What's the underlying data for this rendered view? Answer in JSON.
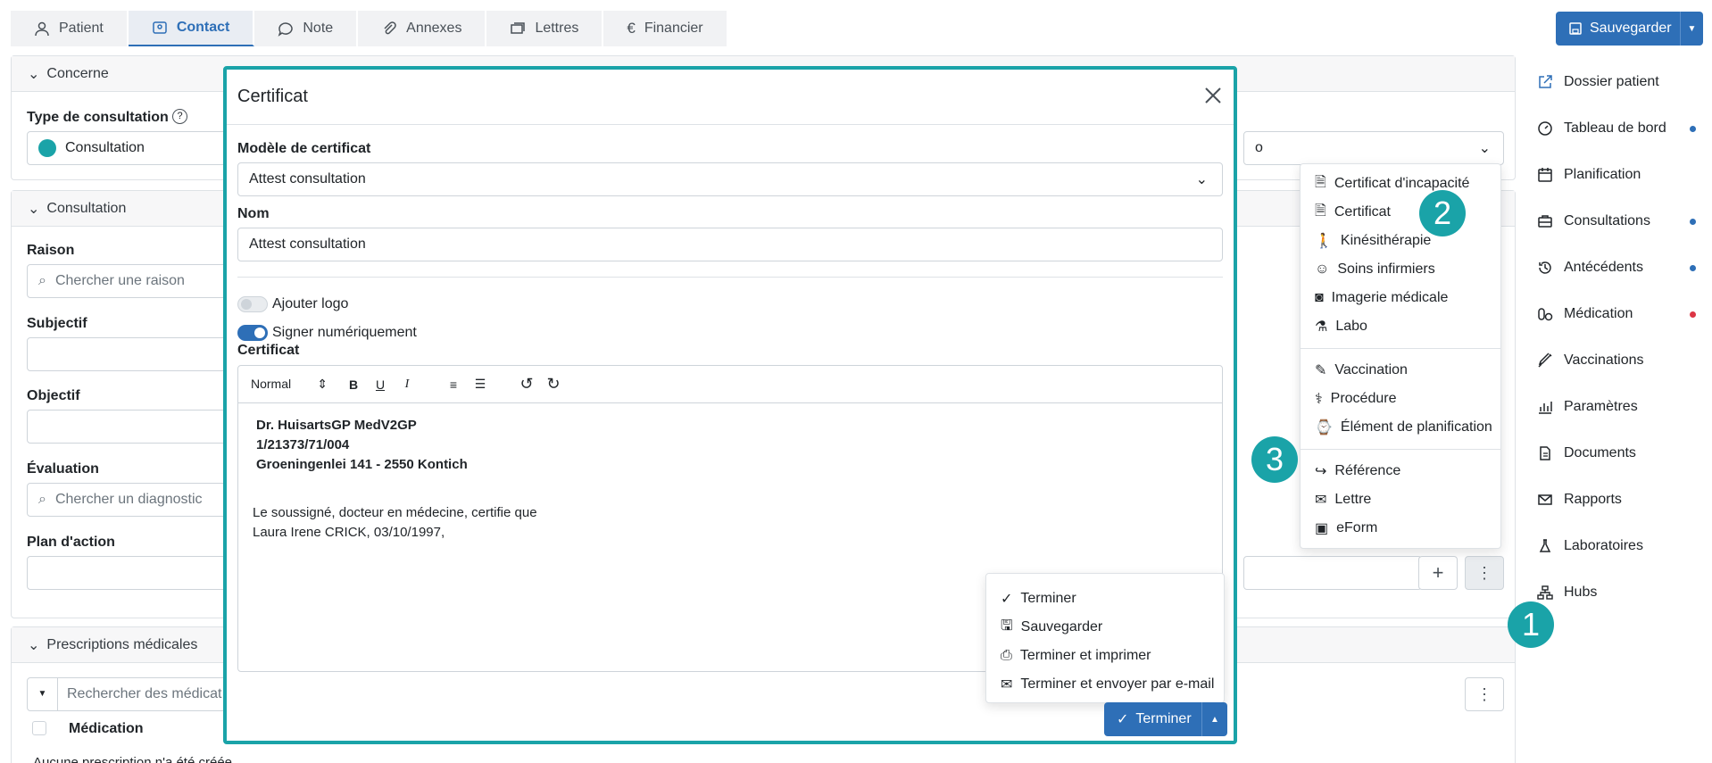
{
  "tabs": [
    {
      "label": "Patient",
      "icon": "user-icon"
    },
    {
      "label": "Contact",
      "icon": "contact-icon"
    },
    {
      "label": "Note",
      "icon": "note-icon"
    },
    {
      "label": "Annexes",
      "icon": "paperclip-icon"
    },
    {
      "label": "Lettres",
      "icon": "letters-icon"
    },
    {
      "label": "Financier",
      "icon": "euro-icon"
    }
  ],
  "save_button": "Sauvegarder",
  "background": {
    "concerne": "Concerne",
    "type_label": "Type de consultation",
    "type_value": "Consultation",
    "consultation": "Consultation",
    "raison": "Raison",
    "raison_placeholder": "Chercher une raison",
    "subjectif": "Subjectif",
    "objectif": "Objectif",
    "evaluation": "Évaluation",
    "evaluation_placeholder": "Chercher un diagnostic",
    "plan": "Plan d'action",
    "prescriptions": "Prescriptions médicales",
    "medication_search": "Rechercher des médicat",
    "medication_col": "Médication",
    "empty_text": "Aucune prescription n'a été créée",
    "right_select_fragment": "o"
  },
  "sidebar": [
    {
      "label": "Dossier patient",
      "icon": "external-link-icon",
      "dot": ""
    },
    {
      "label": "Tableau de bord",
      "icon": "dashboard-icon",
      "dot": "#2e6fb7"
    },
    {
      "label": "Planification",
      "icon": "calendar-icon",
      "dot": ""
    },
    {
      "label": "Consultations",
      "icon": "briefcase-icon",
      "dot": "#2e6fb7"
    },
    {
      "label": "Antécédents",
      "icon": "history-icon",
      "dot": "#2e6fb7"
    },
    {
      "label": "Médication",
      "icon": "pills-icon",
      "dot": "#dc3545"
    },
    {
      "label": "Vaccinations",
      "icon": "syringe-icon",
      "dot": ""
    },
    {
      "label": "Paramètres",
      "icon": "chart-icon",
      "dot": ""
    },
    {
      "label": "Documents",
      "icon": "document-icon",
      "dot": ""
    },
    {
      "label": "Rapports",
      "icon": "mail-icon",
      "dot": ""
    },
    {
      "label": "Laboratoires",
      "icon": "flask-icon",
      "dot": ""
    },
    {
      "label": "Hubs",
      "icon": "hubs-icon",
      "dot": ""
    }
  ],
  "context_menu": {
    "group1": [
      "Certificat d'incapacité",
      "Certificat",
      "Kinésithérapie",
      "Soins infirmiers",
      "Imagerie médicale",
      "Labo"
    ],
    "group2": [
      "Vaccination",
      "Procédure",
      "Élément de planification"
    ],
    "group3": [
      "Référence",
      "Lettre",
      "eForm"
    ]
  },
  "modal": {
    "title": "Certificat",
    "model_label": "Modèle de certificat",
    "model_value": "Attest consultation",
    "name_label": "Nom",
    "name_value": "Attest consultation",
    "logo_label": "Ajouter logo",
    "sign_label": "Signer numériquement",
    "cert_label": "Certificat",
    "format_select": "Normal",
    "body_bold": [
      "Dr. HuisartsGP MedV2GP",
      "1/21373/71/004",
      "Groeningenlei 141 - 2550 Kontich"
    ],
    "body_text": [
      "Le soussigné, docteur en médecine, certifie que",
      "Laura Irene CRICK, 03/10/1997,"
    ],
    "submenu": [
      "Terminer",
      "Sauvegarder",
      "Terminer et imprimer",
      "Terminer et envoyer par e-mail"
    ],
    "finish_button": "Terminer"
  },
  "badges": [
    "1",
    "2",
    "3"
  ],
  "colors": {
    "accent": "#2e6fb7",
    "teal": "#1aa3a8",
    "alert": "#dc3545"
  }
}
